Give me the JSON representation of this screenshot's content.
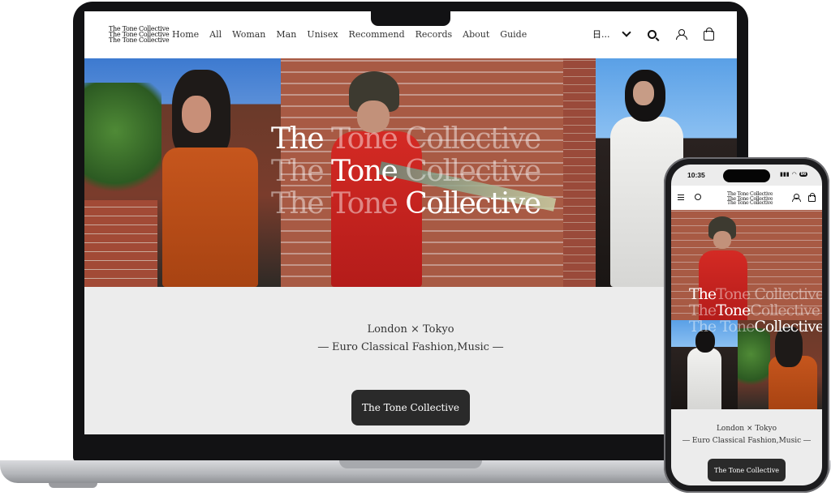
{
  "brand": {
    "logo_lines": [
      "The Tone Collective",
      "The Tone Collective",
      "The Tone Collective"
    ]
  },
  "desktop": {
    "nav": [
      "Home",
      "All",
      "Woman",
      "Man",
      "Unisex",
      "Recommend",
      "Records",
      "About",
      "Guide"
    ],
    "language_label": "日...",
    "hero_title_lines": [
      {
        "a": "The",
        "b": " Tone Collective"
      },
      {
        "a": "The ",
        "b": "Tone",
        "c": " Collective"
      },
      {
        "a": "The Tone ",
        "b": "Collective"
      }
    ],
    "tagline_1": "London × Tokyo",
    "tagline_2": "― Euro Classical Fashion,Music ―",
    "cta_label": "The Tone Collective"
  },
  "phone": {
    "status_time": "10:35",
    "battery": "86",
    "hero_title_lines": [
      {
        "a": "The",
        "b": "Tone Collective"
      },
      {
        "a": "The",
        "b": "Tone",
        "c": "Collective"
      },
      {
        "a": "The Tone",
        "b": "Collective"
      }
    ],
    "tagline_1": "London × Tokyo",
    "tagline_2": "― Euro Classical Fashion,Music ―",
    "cta_label": "The Tone Collective"
  },
  "icons": [
    "chevron-down-icon",
    "search-icon",
    "user-icon",
    "shopping-bag-icon",
    "menu-icon",
    "bell-icon",
    "signal-icon",
    "wifi-icon",
    "battery-icon"
  ],
  "colors": {
    "cta": "#2a2a2a",
    "page_bg": "#ececec",
    "header_bg": "#ffffff"
  }
}
